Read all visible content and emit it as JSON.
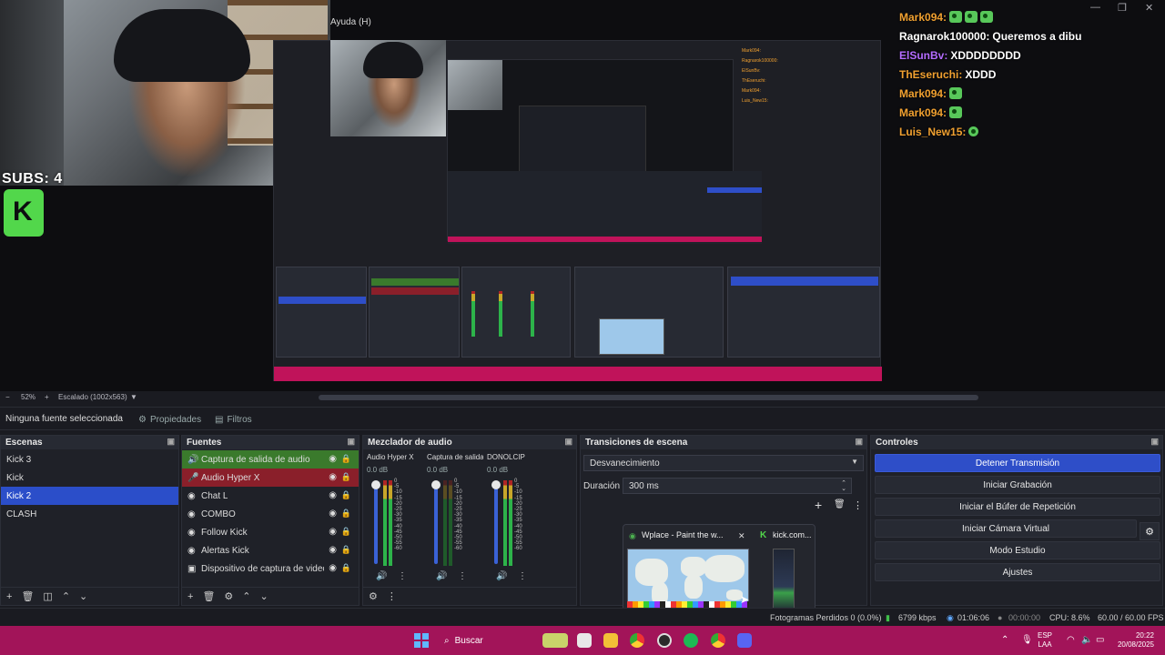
{
  "preview": {
    "subs_text": "SUBS: 4",
    "help_menu": "Ayuda (H)",
    "zoom_minus": "−",
    "zoom_level": "52%",
    "zoom_plus": "+",
    "scale_text": "Escalado (1002x563)",
    "scale_caret": "▼"
  },
  "chat": [
    {
      "user": "Mark094:",
      "color": "#f0a030",
      "text": "",
      "emotes": 3
    },
    {
      "user": "Ragnarok100000:",
      "color": "#ffffff",
      "text": "Queremos a dibu",
      "emotes": 0
    },
    {
      "user": "ElSunBv:",
      "color": "#b46cff",
      "text": "XDDDDDDDD",
      "emotes": 0
    },
    {
      "user": "ThEseruchi:",
      "color": "#f0a030",
      "text": "XDDD",
      "emotes": 0
    },
    {
      "user": "Mark094:",
      "color": "#f0a030",
      "text": "",
      "emotes": 1
    },
    {
      "user": "Mark094:",
      "color": "#f0a030",
      "text": "",
      "emotes": 1
    },
    {
      "user": "Luis_New15:",
      "color": "#f0a030",
      "text": "",
      "emotes": 1
    }
  ],
  "properties_bar": {
    "no_source": "Ninguna fuente seleccionada",
    "properties": "Propiedades",
    "filters": "Filtros"
  },
  "scenes": {
    "title": "Escenas",
    "items": [
      "Kick 3",
      "Kick",
      "Kick 2",
      "CLASH"
    ],
    "selected": "Kick 2"
  },
  "sources": {
    "title": "Fuentes",
    "items": [
      {
        "label": "Captura de salida de audio",
        "icon": "speaker-icon",
        "glyph": "🔊",
        "state": "green"
      },
      {
        "label": "Audio Hyper X",
        "icon": "microphone-icon",
        "glyph": "🎤",
        "state": "red"
      },
      {
        "label": "Chat L",
        "icon": "globe-icon",
        "glyph": "◉",
        "state": ""
      },
      {
        "label": "COMBO",
        "icon": "globe-icon",
        "glyph": "◉",
        "state": ""
      },
      {
        "label": "Follow Kick",
        "icon": "globe-icon",
        "glyph": "◉",
        "state": ""
      },
      {
        "label": "Alertas Kick",
        "icon": "globe-icon",
        "glyph": "◉",
        "state": ""
      },
      {
        "label": "Dispositivo de captura de video",
        "icon": "camera-icon",
        "glyph": "▣",
        "state": ""
      }
    ]
  },
  "mixer": {
    "title": "Mezclador de audio",
    "channels": [
      {
        "name": "Audio Hyper X",
        "db": "0.0 dB",
        "level": 0.7
      },
      {
        "name": "Captura de salida de audio",
        "db": "0.0 dB",
        "level": 0.0
      },
      {
        "name": "DONOLCIP",
        "db": "0.0 dB",
        "level": 0.65
      }
    ],
    "scale": [
      "0",
      "-5",
      "-10",
      "-15",
      "-20",
      "-25",
      "-30",
      "-35",
      "-40",
      "-45",
      "-50",
      "-55",
      "-60"
    ]
  },
  "transitions": {
    "title": "Transiciones de escena",
    "selected": "Desvanecimiento",
    "duration_label": "Duración",
    "duration_value": "300 ms"
  },
  "thumbnail": {
    "tab1": "Wplace - Paint the w...",
    "tab2": "kick.com...",
    "close": "✕"
  },
  "controls": {
    "title": "Controles",
    "buttons": [
      "Detener Transmisión",
      "Iniciar Grabación",
      "Iniciar el Búfer de Repetición",
      "Iniciar Cámara Virtual",
      "Modo Estudio",
      "Ajustes"
    ]
  },
  "status": {
    "frames_lost": "Fotogramas Perdidos 0 (0.0%)",
    "bitrate": "6799 kbps",
    "stream_time": "01:06:06",
    "rec_time": "00:00:00",
    "cpu": "CPU: 8.6%",
    "fps": "60.00 / 60.00 FPS"
  },
  "taskbar": {
    "search_label": "Buscar",
    "lang_top": "ESP",
    "lang_bottom": "LAA",
    "time": "20:22",
    "date": "20/08/2025"
  },
  "colors": {
    "accent": "#2e4ec8",
    "taskbar": "#a21459",
    "source_active": "#3a7a2c",
    "source_muted": "#8a1f2a"
  }
}
